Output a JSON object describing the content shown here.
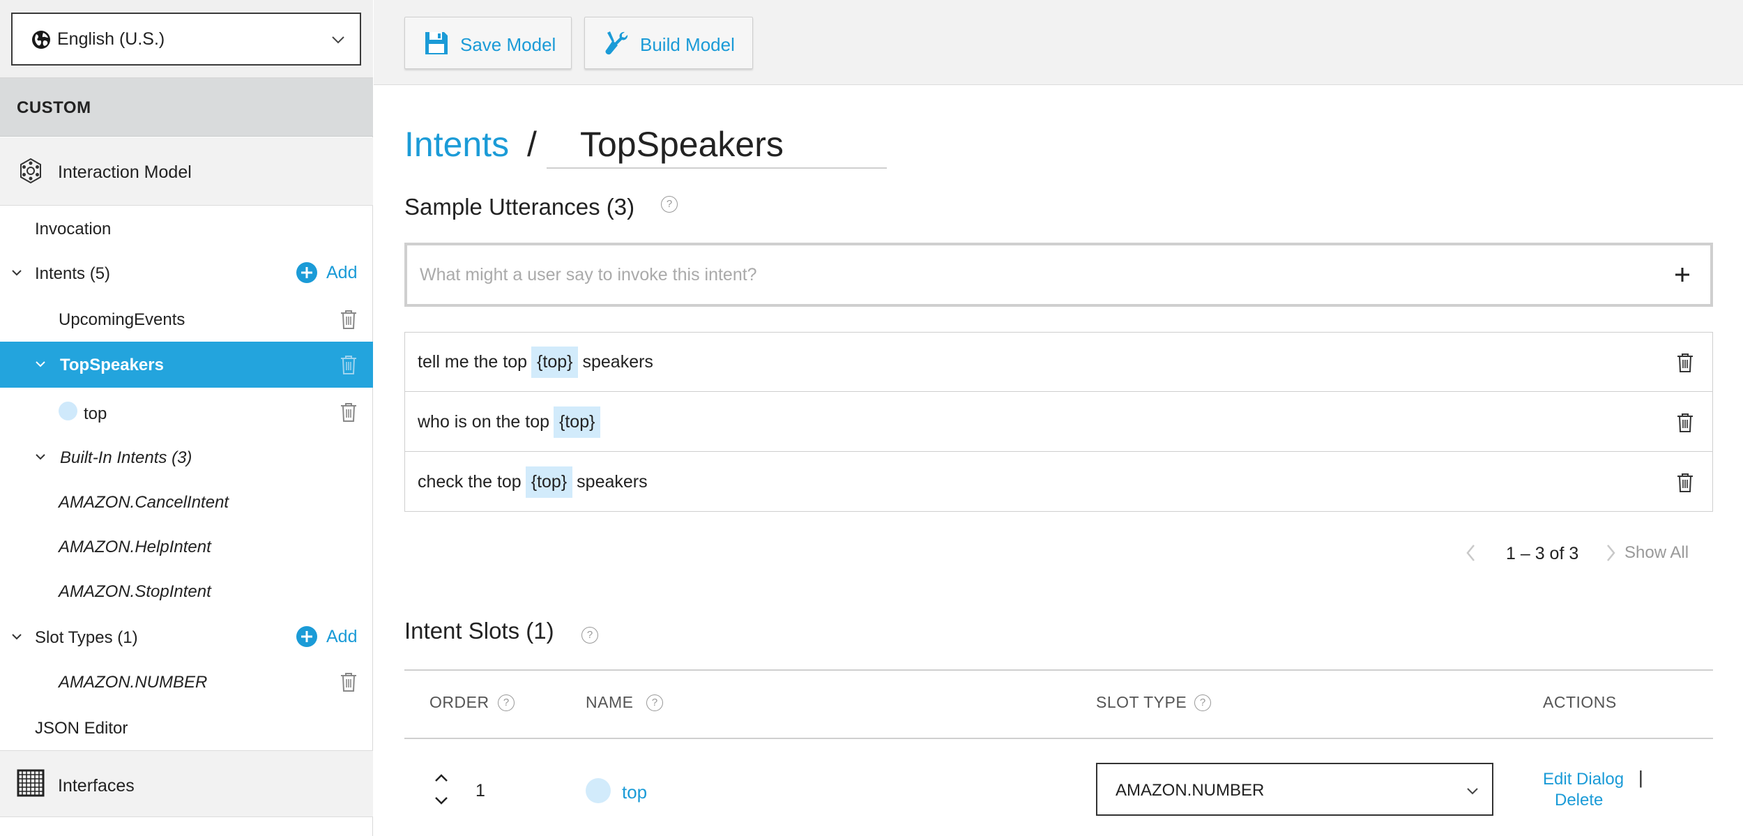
{
  "language": {
    "selected": "English (U.S.)"
  },
  "sidebar": {
    "section_title": "CUSTOM",
    "interaction_model": "Interaction Model",
    "invocation": "Invocation",
    "intents_label": "Intents (5)",
    "add_label": "Add",
    "intents": [
      "UpcomingEvents",
      "TopSpeakers"
    ],
    "selected_intent": "TopSpeakers",
    "slot_child": "top",
    "builtin_label": "Built-In Intents (3)",
    "builtin_intents": [
      "AMAZON.CancelIntent",
      "AMAZON.HelpIntent",
      "AMAZON.StopIntent"
    ],
    "slot_types_label": "Slot Types (1)",
    "slot_types": [
      "AMAZON.NUMBER"
    ],
    "json_editor": "JSON Editor",
    "interfaces": "Interfaces"
  },
  "toolbar": {
    "save_label": "Save Model",
    "build_label": "Build Model"
  },
  "breadcrumb": {
    "parent": "Intents",
    "separator": "/",
    "current": "TopSpeakers"
  },
  "utterances": {
    "title": "Sample Utterances (3)",
    "help": "?",
    "placeholder": "What might a user say to invoke this intent?",
    "rows": [
      {
        "before": "tell me the top",
        "slot": "{top}",
        "after": "speakers"
      },
      {
        "before": "who is on the top",
        "slot": "{top}",
        "after": ""
      },
      {
        "before": "check the top",
        "slot": "{top}",
        "after": "speakers"
      }
    ],
    "pagination": "1 – 3 of 3",
    "show_all": "Show All"
  },
  "slots": {
    "title": "Intent Slots (1)",
    "help": "?",
    "columns": {
      "order": "ORDER",
      "name": "NAME",
      "slot_type": "SLOT TYPE",
      "actions": "ACTIONS"
    },
    "rows": [
      {
        "order": "1",
        "name": "top",
        "slot_type": "AMAZON.NUMBER",
        "edit": "Edit Dialog",
        "separator": "|",
        "delete": "Delete"
      }
    ]
  },
  "colors": {
    "accent": "#1b9bd7",
    "selected_bg": "#23a4dd",
    "slot_highlight": "#d2ebfb"
  }
}
